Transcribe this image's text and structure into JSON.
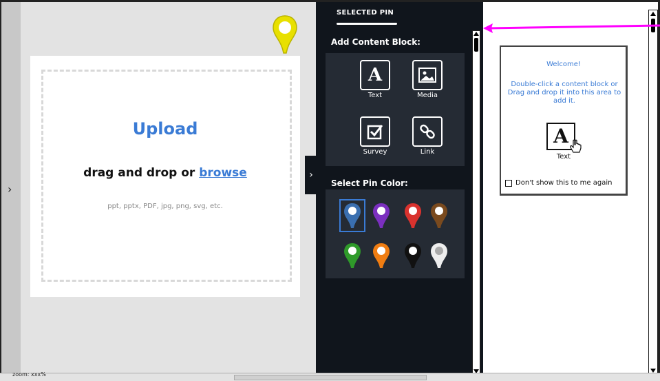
{
  "canvas": {
    "upload_title": "Upload",
    "drag_text": "drag and drop or",
    "browse_link": "browse",
    "file_types": "ppt, pptx, PDF, jpg, png, svg, etc."
  },
  "panel": {
    "title": "SELECTED PIN",
    "add_content_label": "Add Content Block:",
    "blocks": [
      {
        "label": "Text",
        "icon": "text-icon"
      },
      {
        "label": "Media",
        "icon": "image-icon"
      },
      {
        "label": "Survey",
        "icon": "checkbox-icon"
      },
      {
        "label": "Link",
        "icon": "link-icon"
      }
    ],
    "pin_color_label": "Select Pin Color:",
    "pin_colors": [
      {
        "name": "blue",
        "color": "#3a6fb0",
        "selected": true
      },
      {
        "name": "purple",
        "color": "#7b2fbf",
        "selected": false
      },
      {
        "name": "red",
        "color": "#d9322e",
        "selected": false
      },
      {
        "name": "brown",
        "color": "#7a4a1e",
        "selected": false
      },
      {
        "name": "green",
        "color": "#2f9a2a",
        "selected": false
      },
      {
        "name": "orange",
        "color": "#f07d12",
        "selected": false
      },
      {
        "name": "black",
        "color": "#111111",
        "selected": false
      },
      {
        "name": "white",
        "color": "#eeeeee",
        "selected": false
      }
    ]
  },
  "welcome": {
    "title": "Welcome!",
    "body": "Double-click a content block or Drag and drop it into this area to add it.",
    "icon_label": "Text",
    "checkbox_label": "Don't show this to me again"
  },
  "bottom": {
    "zoom_text": "zoom: xxx%"
  },
  "colors": {
    "accent": "#3a7bd5",
    "panel_bg": "#10151c",
    "panel_box": "#252b34",
    "annotation": "#ff00ff",
    "yellow_pin": "#e8e000"
  }
}
